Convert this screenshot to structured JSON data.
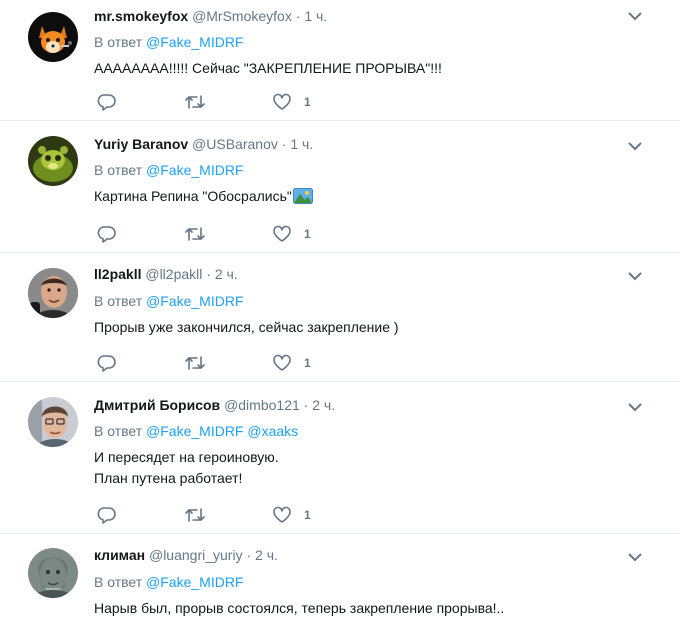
{
  "tweets": [
    {
      "fullname": "mr.smokeyfox",
      "handle": "@MrSmokeyfox",
      "dot": "·",
      "time": "1 ч.",
      "reply_prefix": "В ответ",
      "mentions": [
        "@Fake_MIDRF"
      ],
      "lines": [
        "АААААААА!!!!! Сейчас \"ЗАКРЕПЛЕНИЕ ПРОРЫВА\"!!!"
      ],
      "likes": "1"
    },
    {
      "fullname": "Yuriy Baranov",
      "handle": "@USBaranov",
      "dot": "·",
      "time": "1 ч.",
      "reply_prefix": "В ответ",
      "mentions": [
        "@Fake_MIDRF"
      ],
      "lines": [
        "Картина Репина \"Обосрались\""
      ],
      "likes": "1"
    },
    {
      "fullname": "ll2pakll",
      "handle": "@ll2pakll",
      "dot": "·",
      "time": "2 ч.",
      "reply_prefix": "В ответ",
      "mentions": [
        "@Fake_MIDRF"
      ],
      "lines": [
        "Прорыв уже закончился, сейчас закрепление )"
      ],
      "likes": "1"
    },
    {
      "fullname": "Дмитрий Борисов",
      "handle": "@dimbo121",
      "dot": "·",
      "time": "2 ч.",
      "reply_prefix": "В ответ",
      "mentions": [
        "@Fake_MIDRF",
        "@xaaks"
      ],
      "lines": [
        "И пересядет на героиновую.",
        "План путена работает!"
      ],
      "likes": "1"
    },
    {
      "fullname": "климан",
      "handle": "@luangri_yuriy",
      "dot": "·",
      "time": "2 ч.",
      "reply_prefix": "В ответ",
      "mentions": [
        "@Fake_MIDRF"
      ],
      "lines": [
        "Нарыв был, прорыв состоялся, теперь закрепление прорыва!.."
      ],
      "likes": ""
    }
  ],
  "icons": {
    "reply": "reply-icon",
    "retweet": "retweet-icon",
    "like": "heart-icon",
    "menu": "chevron-down-icon",
    "emoji": "picture-emoji-icon"
  },
  "colors": {
    "link": "#1da1f2",
    "secondary_text": "#657786",
    "divider": "#e6ecf0"
  }
}
